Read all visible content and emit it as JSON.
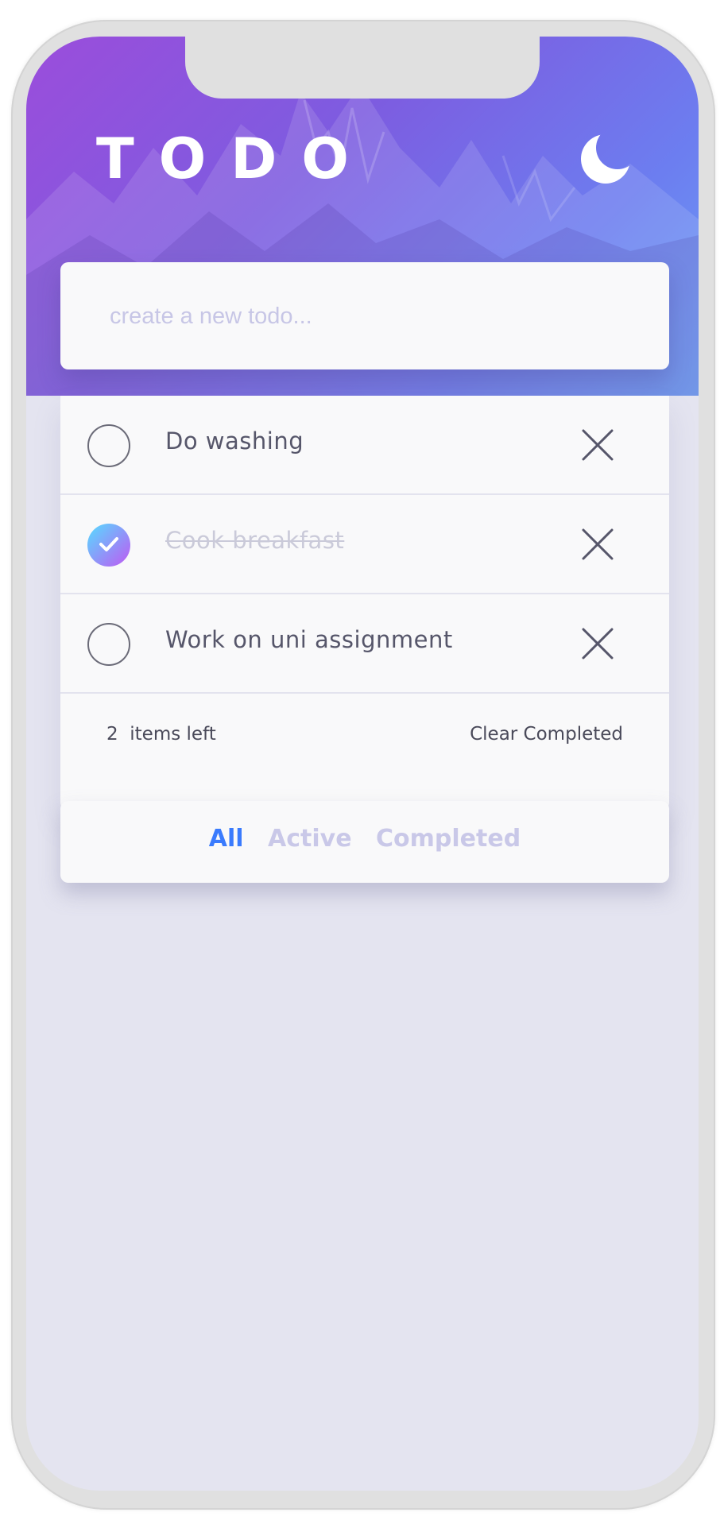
{
  "app": {
    "title": "TODO",
    "theme_icon": "moon-icon"
  },
  "new_todo": {
    "placeholder": "create a new todo...",
    "value": ""
  },
  "todos": [
    {
      "text": "Do washing",
      "completed": false
    },
    {
      "text": "Cook breakfast",
      "completed": true
    },
    {
      "text": "Work on uni assignment",
      "completed": false
    }
  ],
  "footer": {
    "items_left": "2  items left",
    "clear_label": "Clear Completed"
  },
  "filters": [
    {
      "label": "All",
      "active": true
    },
    {
      "label": "Active",
      "active": false
    },
    {
      "label": "Completed",
      "active": false
    }
  ],
  "colors": {
    "accent": "#3a7bfd",
    "gradient_start": "#55ddff",
    "gradient_end": "#c058f3",
    "text": "#56566a",
    "muted": "#c9c8e8",
    "background": "#e4e4f0"
  }
}
